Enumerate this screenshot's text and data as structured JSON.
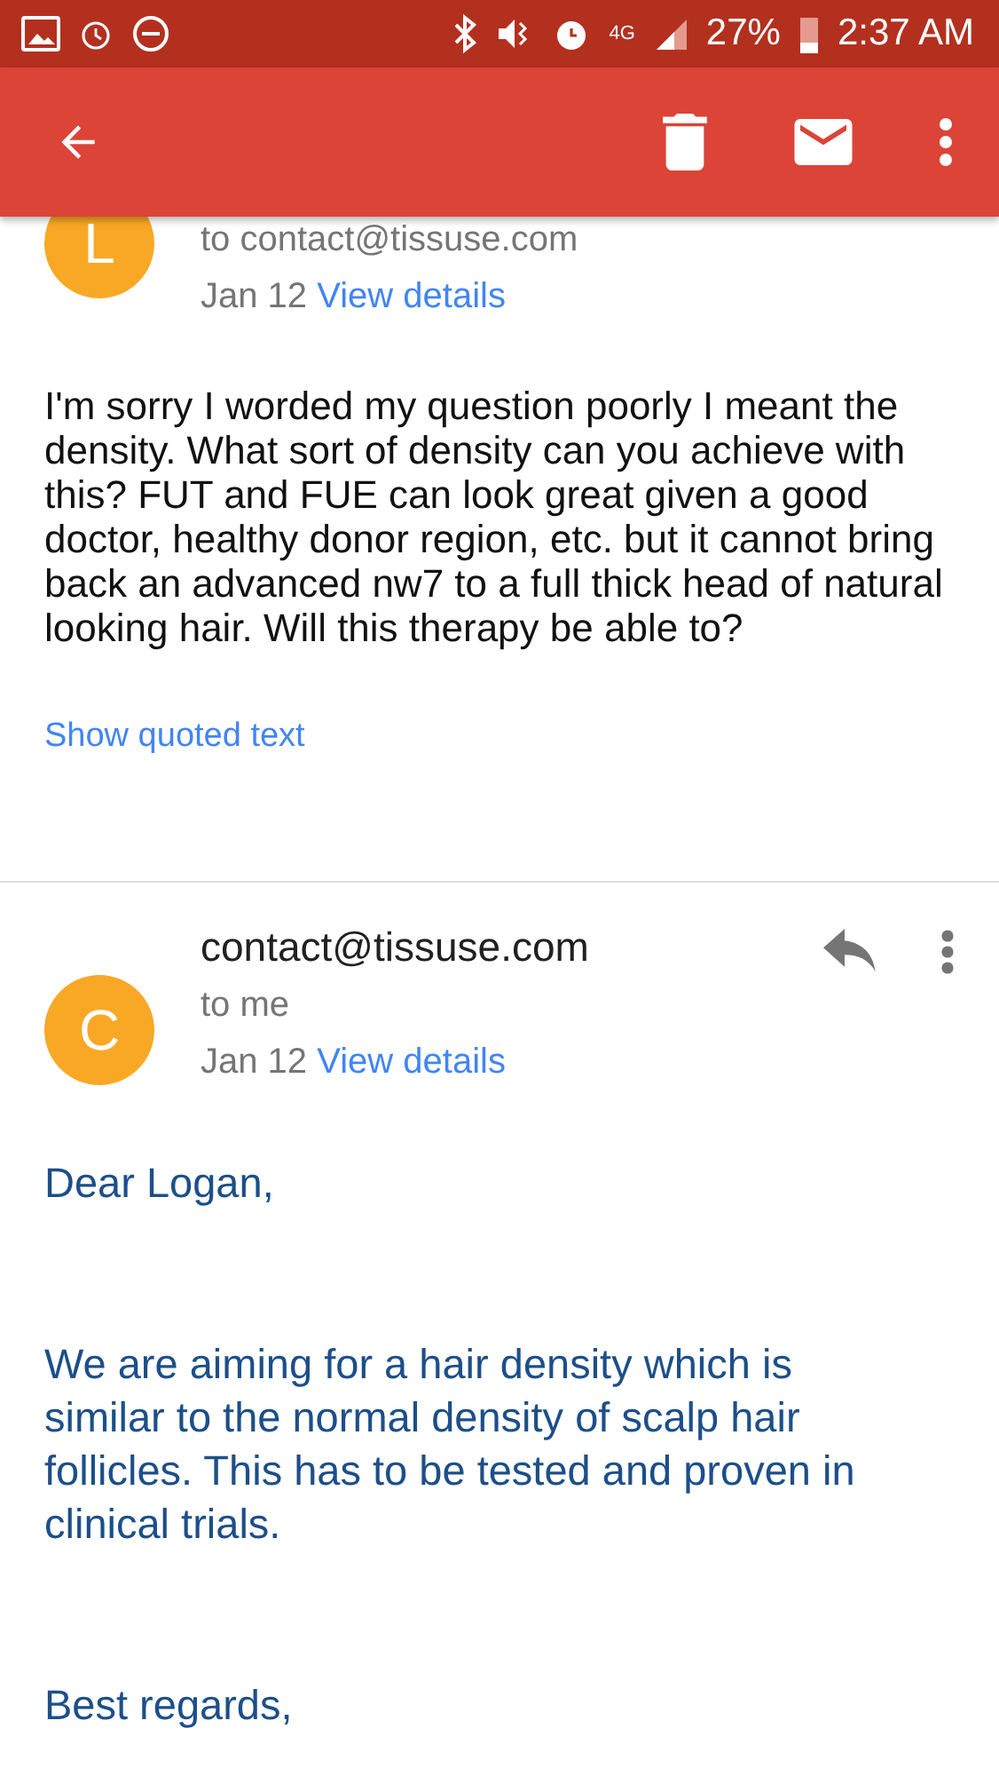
{
  "status_bar": {
    "battery_text": "27%",
    "time": "2:37 AM",
    "network": "4G"
  },
  "messages": [
    {
      "avatar_letter": "L",
      "recipient": "to contact@tissuse.com",
      "date": "Jan 12",
      "details_link": "View details",
      "body": [
        "I'm sorry I worded my question poorly I meant the density.  What sort of density can you achieve with this?  FUT and FUE can look great given a good doctor, healthy donor region, etc. but it cannot bring back an advanced nw7 to a full thick head of natural looking hair.  Will this therapy be able to?"
      ],
      "quoted_link": "Show quoted text"
    },
    {
      "avatar_letter": "C",
      "sender": "contact@tissuse.com",
      "recipient": "to me",
      "date": "Jan 12",
      "details_link": "View details",
      "body": [
        "Dear Logan,",
        "We are aiming for a hair density which is similar to the normal density of scalp hair follicles. This has to be tested and proven in clinical trials.",
        "Best regards,"
      ]
    }
  ]
}
